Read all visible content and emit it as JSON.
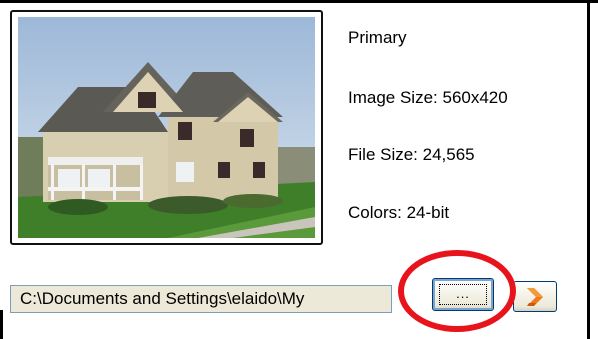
{
  "image_info": {
    "label": "Primary",
    "image_size": "Image Size: 560x420",
    "file_size": "File Size: 24,565",
    "colors": "Colors: 24-bit"
  },
  "path_field": {
    "value": "C:\\Documents and Settings\\elaido\\My"
  },
  "browse_button": {
    "label": "..."
  },
  "clear_button": {
    "icon": "clear-icon"
  },
  "colors": {
    "annotation_red": "#e8141c",
    "button_border": "#003c74",
    "field_background": "#ece9d8",
    "clear_icon_orange": "#f07a1a"
  }
}
